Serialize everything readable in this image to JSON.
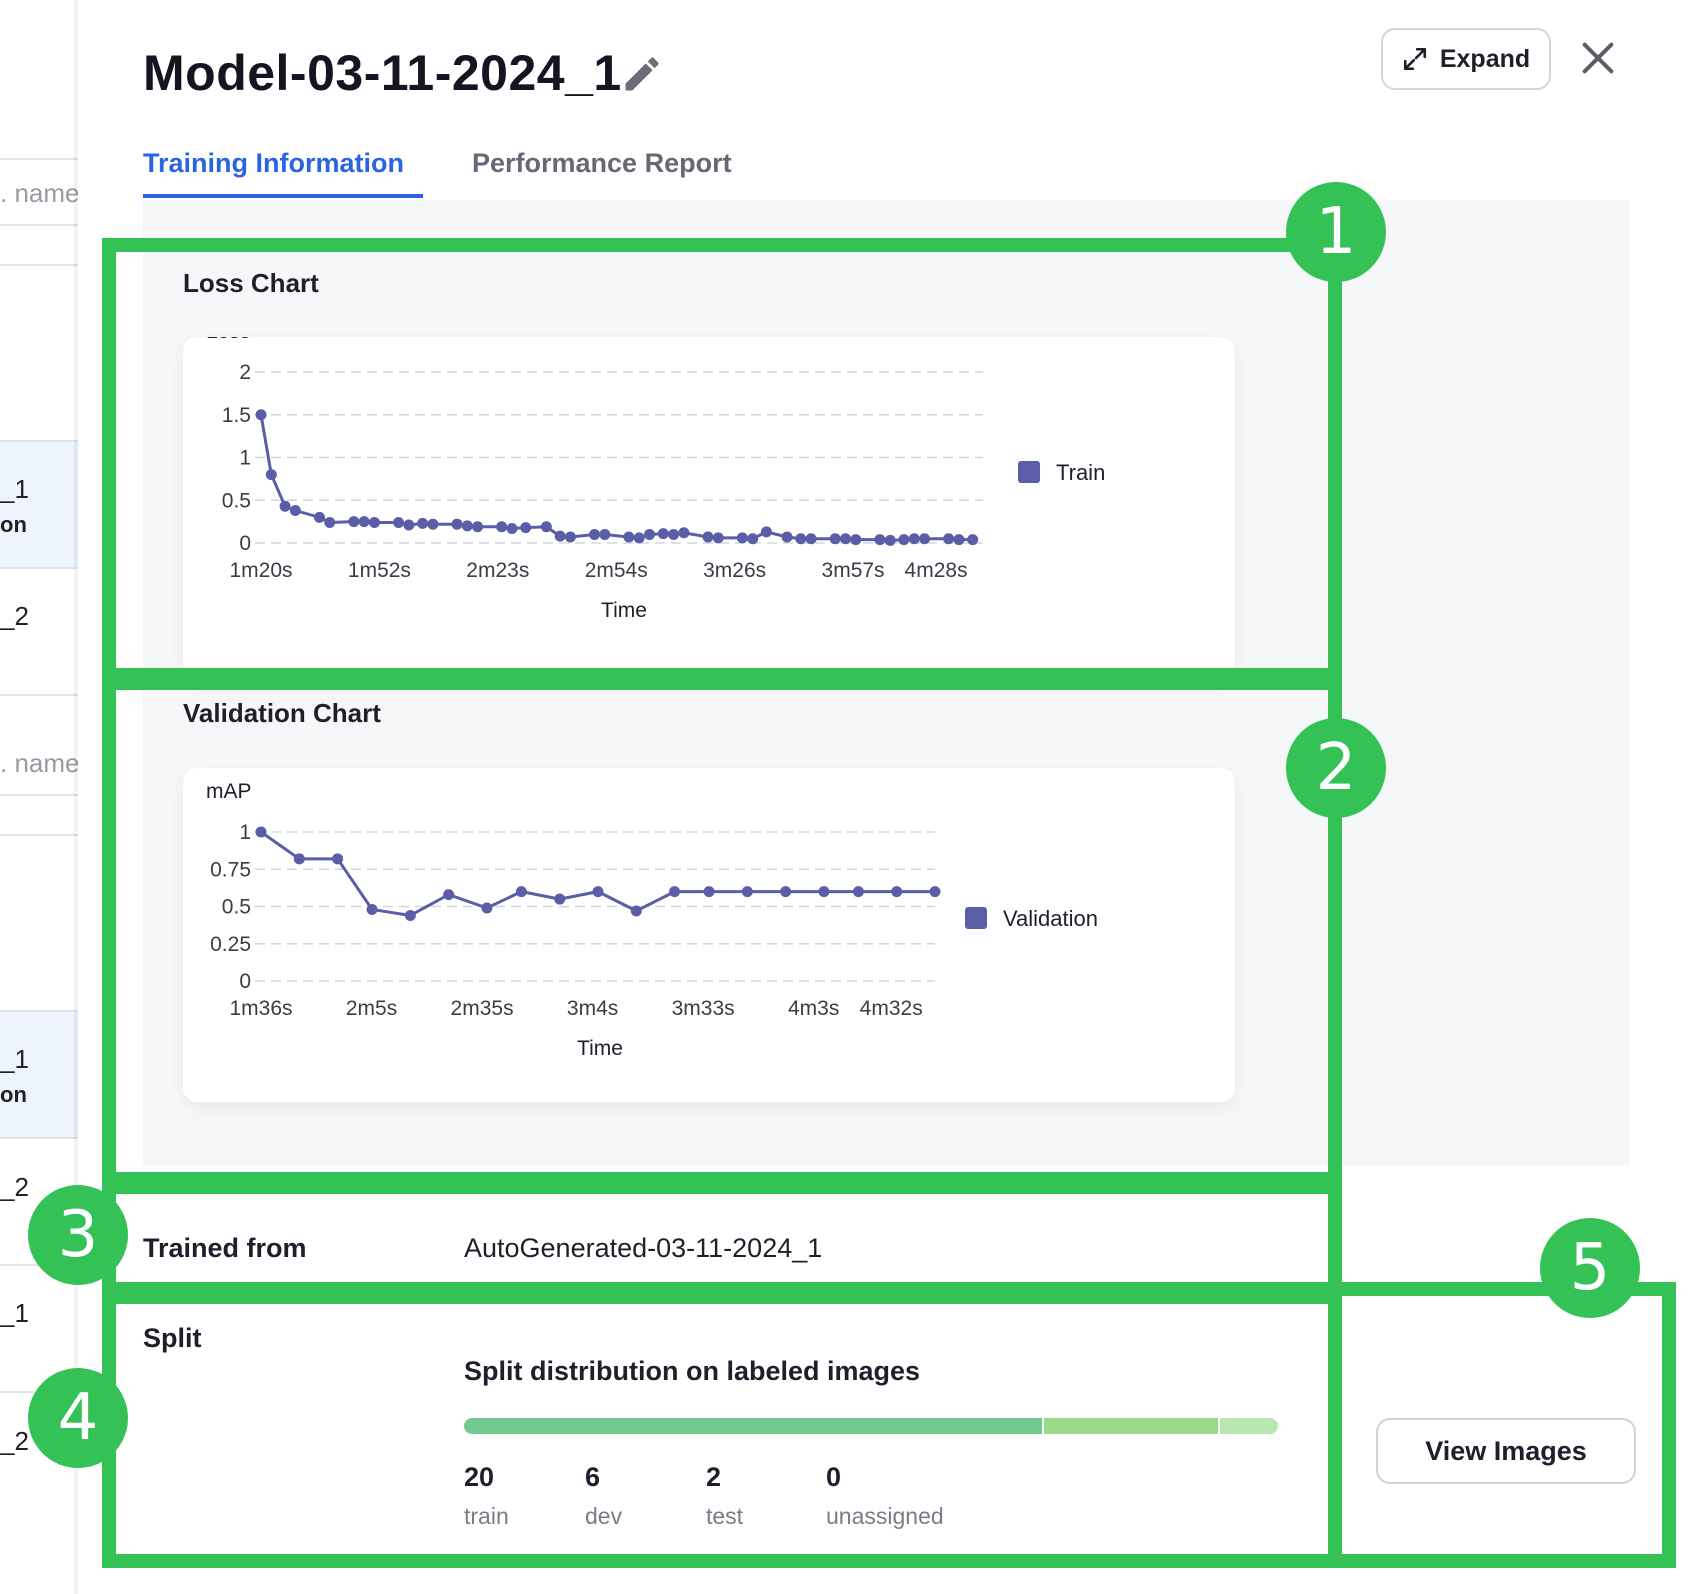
{
  "background_list": {
    "items": [
      {
        "text": ". name",
        "kind": "name"
      },
      {
        "text": "_1",
        "kind": "plain"
      },
      {
        "text": "on",
        "kind": "bold"
      },
      {
        "text": "_2",
        "kind": "plain"
      },
      {
        "text": ". name",
        "kind": "name"
      },
      {
        "text": "_1",
        "kind": "plain"
      },
      {
        "text": "on",
        "kind": "bold"
      },
      {
        "text": "_2",
        "kind": "plain"
      },
      {
        "text": "_1",
        "kind": "plain"
      },
      {
        "text": "_2",
        "kind": "plain"
      }
    ]
  },
  "header": {
    "title": "Model-03-11-2024_1",
    "expand_label": "Expand"
  },
  "tabs": [
    {
      "label": "Training Information",
      "active": true
    },
    {
      "label": "Performance Report",
      "active": false
    }
  ],
  "loss_chart": {
    "section_title": "Loss Chart"
  },
  "validation_chart": {
    "section_title": "Validation Chart"
  },
  "chart_data": [
    {
      "type": "line",
      "title": "Loss Chart",
      "ylabel": "Loss",
      "xlabel": "Time",
      "ylim": [
        0,
        2
      ],
      "yticks": [
        "0",
        "0.5",
        "1",
        "1.5",
        "2"
      ],
      "xticks": [
        "1m20s",
        "1m52s",
        "2m23s",
        "2m54s",
        "3m26s",
        "3m57s",
        "4m28s"
      ],
      "x_seconds_range": [
        80,
        290
      ],
      "grid": true,
      "legend_position": "right",
      "series": [
        {
          "name": "Train",
          "color": "#5b5ea6",
          "x_seconds": [
            80,
            83,
            87,
            90,
            97,
            100,
            107,
            110,
            113,
            120,
            123,
            127,
            130,
            137,
            140,
            143,
            150,
            153,
            157,
            163,
            167,
            170,
            177,
            180,
            187,
            190,
            193,
            197,
            200,
            203,
            210,
            213,
            220,
            223,
            227,
            233,
            237,
            240,
            247,
            250,
            253,
            260,
            263,
            267,
            270,
            273,
            280,
            283,
            287
          ],
          "values": [
            1.5,
            0.8,
            0.43,
            0.38,
            0.3,
            0.24,
            0.25,
            0.25,
            0.24,
            0.24,
            0.21,
            0.23,
            0.22,
            0.22,
            0.2,
            0.19,
            0.19,
            0.17,
            0.18,
            0.19,
            0.08,
            0.07,
            0.1,
            0.1,
            0.07,
            0.06,
            0.1,
            0.11,
            0.1,
            0.12,
            0.07,
            0.06,
            0.06,
            0.05,
            0.13,
            0.07,
            0.05,
            0.05,
            0.05,
            0.05,
            0.04,
            0.04,
            0.03,
            0.04,
            0.05,
            0.05,
            0.05,
            0.04,
            0.04
          ]
        }
      ]
    },
    {
      "type": "line",
      "title": "Validation Chart",
      "ylabel": "mAP",
      "xlabel": "Time",
      "ylim": [
        0,
        1
      ],
      "yticks": [
        "0",
        "0.25",
        "0.5",
        "0.75",
        "1"
      ],
      "xticks": [
        "1m36s",
        "2m5s",
        "2m35s",
        "3m4s",
        "3m33s",
        "4m3s",
        "4m32s"
      ],
      "x_seconds_range": [
        96,
        272
      ],
      "grid": true,
      "legend_position": "right",
      "series": [
        {
          "name": "Validation",
          "color": "#5b5ea6",
          "x_seconds": [
            96,
            106,
            116,
            125,
            135,
            145,
            155,
            164,
            174,
            184,
            194,
            204,
            213,
            223,
            233,
            243,
            252,
            262,
            272
          ],
          "values": [
            1.0,
            0.82,
            0.82,
            0.48,
            0.44,
            0.58,
            0.49,
            0.6,
            0.55,
            0.6,
            0.47,
            0.6,
            0.6,
            0.6,
            0.6,
            0.6,
            0.6,
            0.6,
            0.6
          ]
        }
      ]
    }
  ],
  "trained_from": {
    "label": "Trained from",
    "value": "AutoGenerated-03-11-2024_1"
  },
  "split": {
    "label": "Split",
    "title": "Split distribution on labeled images",
    "stats": [
      {
        "count": "20",
        "caption": "train",
        "color": "#74c98f"
      },
      {
        "count": "6",
        "caption": "dev",
        "color": "#9ad98a"
      },
      {
        "count": "2",
        "caption": "test",
        "color": "#b9e6b3"
      },
      {
        "count": "0",
        "caption": "unassigned",
        "color": "#e8eaed"
      }
    ],
    "bar_fractions": [
      0.714,
      0.214,
      0.072,
      0.0
    ]
  },
  "view_images_label": "View Images",
  "annotations": {
    "badges": [
      "1",
      "2",
      "3",
      "4",
      "5"
    ],
    "color": "#34c257"
  }
}
